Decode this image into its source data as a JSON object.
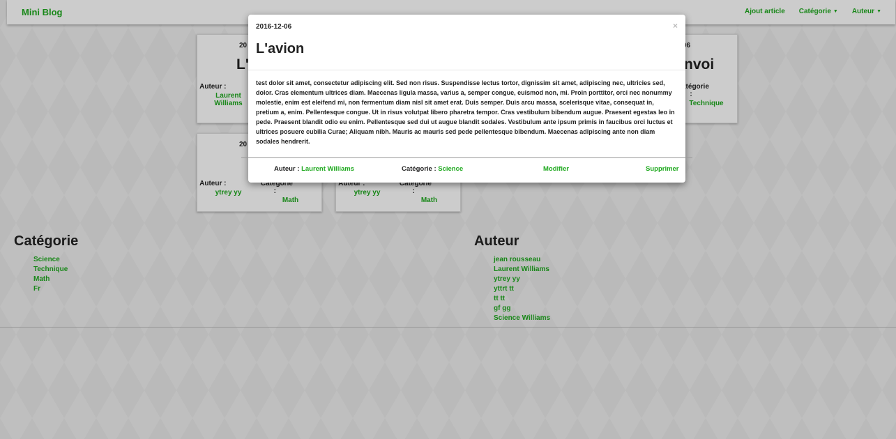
{
  "navbar": {
    "brand": "Mini Blog",
    "links": [
      {
        "label": "Ajout article",
        "caret": false
      },
      {
        "label": "Catégorie",
        "caret": true
      },
      {
        "label": "Auteur",
        "caret": true
      }
    ]
  },
  "cards": [
    {
      "date": "20",
      "title": "L'a",
      "author_label": "Auteur :",
      "author": "Laurent Williams",
      "category_label": "",
      "category": ""
    },
    {
      "date": "06",
      "title": "nvoi",
      "author_label": "",
      "author": "",
      "category_label": "Catégorie :",
      "category": "Technique"
    },
    {
      "date": "20",
      "title": "",
      "author_label": "Auteur :",
      "author": "ytrey yy",
      "category_label": "Catégorie :",
      "category": "Math"
    },
    {
      "date": "",
      "title": "",
      "author_label": "Auteur :",
      "author": "ytrey yy",
      "category_label": "Catégorie :",
      "category": "Math"
    }
  ],
  "categories": {
    "heading": "Catégorie",
    "items": [
      "Science",
      "Technique",
      "Math",
      "Fr"
    ]
  },
  "authors": {
    "heading": "Auteur",
    "items": [
      "jean rousseau",
      "Laurent Williams",
      "ytrey yy",
      "yttrt tt",
      "tt tt",
      "gf gg",
      "Science Williams"
    ]
  },
  "modal": {
    "date": "2016-12-06",
    "close": "×",
    "title": "L'avion",
    "body": "test dolor sit amet, consectetur adipiscing elit. Sed non risus. Suspendisse lectus tortor, dignissim sit amet, adipiscing nec, ultricies sed, dolor. Cras elementum ultrices diam. Maecenas ligula massa, varius a, semper congue, euismod non, mi. Proin porttitor, orci nec nonummy molestie, enim est eleifend mi, non fermentum diam nisl sit amet erat. Duis semper. Duis arcu massa, scelerisque vitae, consequat in, pretium a, enim. Pellentesque congue. Ut in risus volutpat libero pharetra tempor. Cras vestibulum bibendum augue. Praesent egestas leo in pede. Praesent blandit odio eu enim. Pellentesque sed dui ut augue blandit sodales. Vestibulum ante ipsum primis in faucibus orci luctus et ultrices posuere cubilia Curae; Aliquam nibh. Mauris ac mauris sed pede pellentesque bibendum. Maecenas adipiscing ante non diam sodales hendrerit.",
    "author_label": "Auteur :",
    "author": "Laurent Williams",
    "category_label": "Catégorie :",
    "category": "Science",
    "edit": "Modifier",
    "delete": "Supprimer"
  },
  "colors": {
    "accent": "#1fa91f",
    "text": "#222222",
    "background": "#efefef"
  }
}
